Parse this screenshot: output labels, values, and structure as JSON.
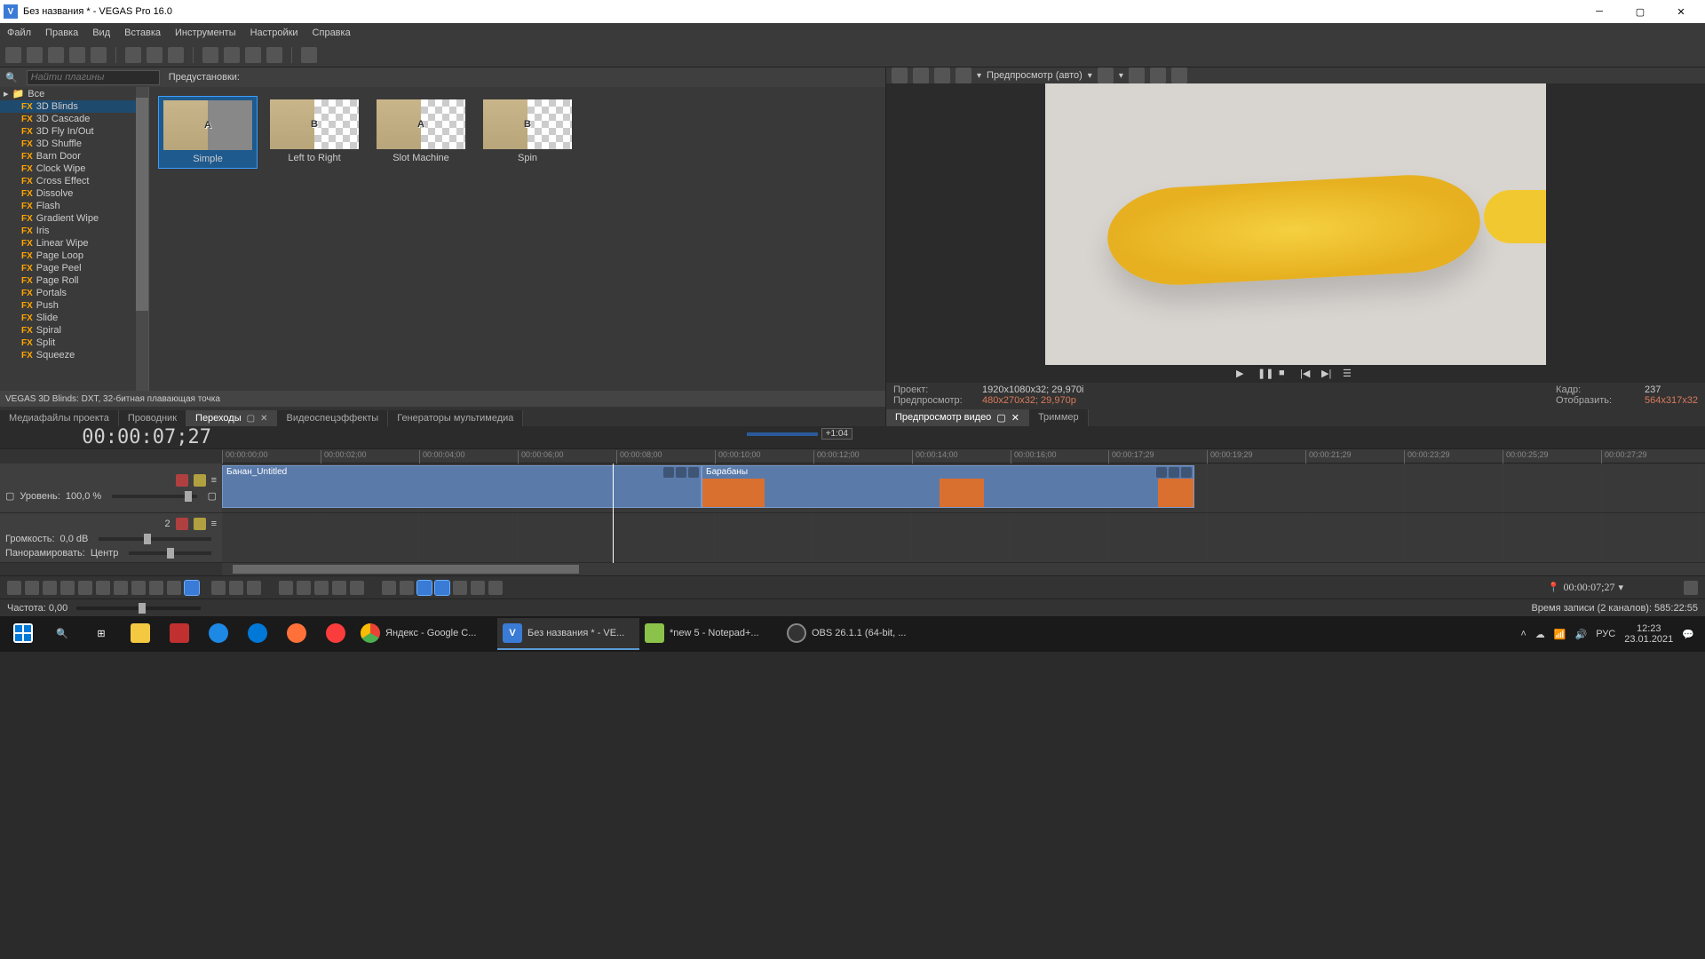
{
  "titlebar": {
    "title": "Без названия * - VEGAS Pro 16.0"
  },
  "menubar": [
    "Файл",
    "Правка",
    "Вид",
    "Вставка",
    "Инструменты",
    "Настройки",
    "Справка"
  ],
  "fx": {
    "search_placeholder": "Найти плагины",
    "preset_label": "Предустановки:",
    "root": "Все",
    "items": [
      "3D Blinds",
      "3D Cascade",
      "3D Fly In/Out",
      "3D Shuffle",
      "Barn Door",
      "Clock Wipe",
      "Cross Effect",
      "Dissolve",
      "Flash",
      "Gradient Wipe",
      "Iris",
      "Linear Wipe",
      "Page Loop",
      "Page Peel",
      "Page Roll",
      "Portals",
      "Push",
      "Slide",
      "Spiral",
      "Split",
      "Squeeze"
    ],
    "selected": "3D Blinds",
    "footer": "VEGAS 3D Blinds: DXT, 32-битная плавающая точка"
  },
  "presets": [
    {
      "label": "Simple",
      "letter": "A",
      "selected": true
    },
    {
      "label": "Left to Right",
      "letter": "B",
      "selected": false
    },
    {
      "label": "Slot Machine",
      "letter": "A",
      "selected": false
    },
    {
      "label": "Spin",
      "letter": "B",
      "selected": false
    }
  ],
  "lefttabs": [
    "Медиафайлы проекта",
    "Проводник",
    "Переходы",
    "Видеоспецэффекты",
    "Генераторы мультимедиа"
  ],
  "lefttabs_active": 2,
  "preview": {
    "mode": "Предпросмотр (авто)",
    "project_label": "Проект:",
    "project_val": "1920x1080x32; 29,970i",
    "preview_label": "Предпросмотр:",
    "preview_val": "480x270x32; 29,970p",
    "frame_label": "Кадр:",
    "frame_val": "237",
    "display_label": "Отобразить:",
    "display_val": "564x317x32"
  },
  "righttabs": [
    "Предпросмотр видео",
    "Триммер"
  ],
  "righttabs_active": 0,
  "timeline": {
    "cursor": "00:00:07;27",
    "zoom_tag": "+1:04",
    "ticks": [
      "00:00:00;00",
      "00:00:02;00",
      "00:00:04;00",
      "00:00:06;00",
      "00:00:08;00",
      "00:00:10;00",
      "00:00:12;00",
      "00:00:14;00",
      "00:00:16;00",
      "00:00:17;29",
      "00:00:19;29",
      "00:00:21;29",
      "00:00:23;29",
      "00:00:25;29",
      "00:00:27;29"
    ],
    "track1": {
      "level_label": "Уровень:",
      "level_val": "100,0 %",
      "clip1_name": "Банан_Untitled",
      "clip2_name": "Барабаны"
    },
    "track2": {
      "num": "2",
      "vol_label": "Громкость:",
      "vol_val": "0,0 dB",
      "pan_label": "Панорамировать:",
      "pan_val": "Центр"
    }
  },
  "status": {
    "left": "Частота: 0,00",
    "right_time": "00:00:07;27",
    "record": "Время записи (2 каналов): 585:22:55"
  },
  "taskbar": {
    "items": [
      {
        "label": "",
        "color": "#0078d7",
        "type": "start"
      },
      {
        "label": "",
        "color": "#333",
        "type": "search"
      },
      {
        "label": "",
        "color": "#333",
        "type": "taskview"
      },
      {
        "label": "",
        "color": "#f5c842",
        "type": "explorer"
      },
      {
        "label": "",
        "color": "#c03030",
        "type": "app1"
      },
      {
        "label": "",
        "color": "#1e88e5",
        "type": "ie"
      },
      {
        "label": "",
        "color": "#0078d7",
        "type": "edge"
      },
      {
        "label": "",
        "color": "#ff7139",
        "type": "firefox"
      },
      {
        "label": "",
        "color": "#fa3c3c",
        "type": "opera"
      },
      {
        "label": "Яндекс - Google C...",
        "color": "#4caf50",
        "type": "chrome",
        "wide": true
      },
      {
        "label": "Без названия * - VE...",
        "color": "#3a7bd5",
        "type": "vegas",
        "wide": true,
        "active": true
      },
      {
        "label": "*new 5 - Notepad+...",
        "color": "#8bc34a",
        "type": "npp",
        "wide": true
      },
      {
        "label": "OBS 26.1.1 (64-bit, ...",
        "color": "#333",
        "type": "obs",
        "wide": true
      }
    ],
    "lang": "РУС",
    "time": "12:23",
    "date": "23.01.2021"
  }
}
